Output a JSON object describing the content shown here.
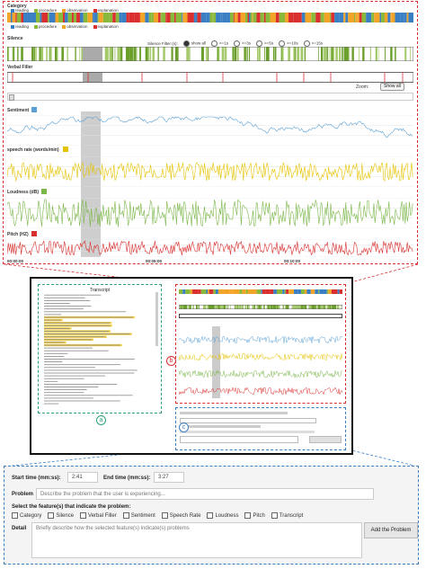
{
  "top": {
    "category_label": "Category",
    "category_legend": [
      {
        "name": "reading",
        "color": "#3a7fc4"
      },
      {
        "name": "procedure",
        "color": "#8ab83a"
      },
      {
        "name": "observation",
        "color": "#f2a428"
      },
      {
        "name": "explanation",
        "color": "#d9302f"
      }
    ],
    "silence_label": "Silence",
    "silence_filter_label": "Silence Filter (s):",
    "silence_filter_options": [
      "show all",
      ">=1s",
      ">=3s",
      ">=5s",
      ">=10s",
      ">=15s"
    ],
    "verbal_filler_label": "Verbal Filler",
    "zoom_label": "Zoom:",
    "show_all_label": "Show all",
    "sentiment_label": "Sentiment",
    "speech_rate_label": "speech rate (words/min)",
    "loudness_label": "Loudness (dB)",
    "pitch_label": "Pitch (HZ)",
    "time_ticks": [
      "00:00:00",
      "00:05:00",
      "00:10:00"
    ],
    "colors": {
      "sentiment": "#5aa0d6",
      "speech_rate": "#e6c300",
      "loudness": "#7ab648",
      "pitch": "#d9302f"
    }
  },
  "overview": {
    "transcript_title": "Transcript",
    "label_a": "a",
    "label_b": "b",
    "label_c": "c"
  },
  "form": {
    "start_label": "Start time (mm:ss):",
    "start_value": "2:41",
    "end_label": "End time (mm:ss):",
    "end_value": "3:27",
    "problem_label": "Problem",
    "problem_placeholder": "Describe the problem that the user is experiencing...",
    "features_label": "Select the feature(s) that indicate the problem:",
    "features": [
      "Category",
      "Silence",
      "Verbal Filler",
      "Sentiment",
      "Speech Rate",
      "Loudness",
      "Pitch",
      "Transcript"
    ],
    "detail_label": "Detail",
    "detail_placeholder": "Briefly describe how the selected feature(s) indicate(s) problems",
    "add_button": "Add the Problem"
  }
}
